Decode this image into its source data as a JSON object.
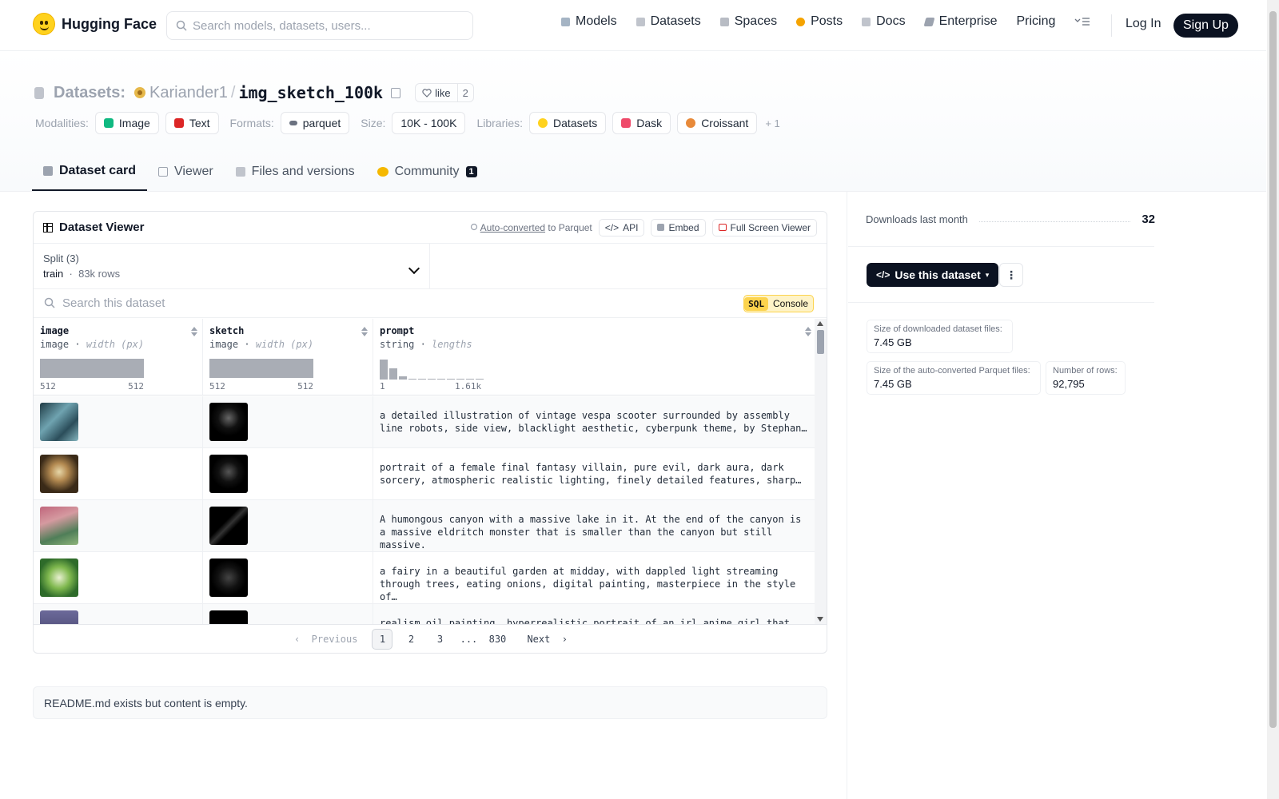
{
  "nav": {
    "brand": "Hugging Face",
    "search_placeholder": "Search models, datasets, users...",
    "links": [
      "Models",
      "Datasets",
      "Spaces",
      "Posts",
      "Docs",
      "Enterprise",
      "Pricing"
    ],
    "login": "Log In",
    "signup": "Sign Up"
  },
  "header": {
    "section": "Datasets:",
    "owner": "Kariander1",
    "slash": "/",
    "name": "img_sketch_100k",
    "like_label": "like",
    "like_count": "2",
    "modalities_label": "Modalities:",
    "modalities": [
      "Image",
      "Text"
    ],
    "formats_label": "Formats:",
    "formats": [
      "parquet"
    ],
    "size_label": "Size:",
    "size": "10K - 100K",
    "libraries_label": "Libraries:",
    "libraries": [
      "Datasets",
      "Dask",
      "Croissant"
    ],
    "libraries_more": "+ 1"
  },
  "tabs": [
    {
      "label": "Dataset card",
      "active": true
    },
    {
      "label": "Viewer"
    },
    {
      "label": "Files and versions"
    },
    {
      "label": "Community",
      "badge": "1"
    }
  ],
  "viewer": {
    "title": "Dataset Viewer",
    "auto_converted": "Auto-converted",
    "to_parquet": "to Parquet",
    "api": "API",
    "embed": "Embed",
    "fullscreen": "Full Screen Viewer",
    "split_label": "Split (3)",
    "split_name": "train",
    "split_rows": "83k rows",
    "search_placeholder": "Search this dataset",
    "sql_tag": "SQL",
    "sql_label": "Console",
    "columns": [
      {
        "name": "image",
        "type": "image",
        "stat": "width (px)",
        "min": "512",
        "max": "512"
      },
      {
        "name": "sketch",
        "type": "image",
        "stat": "width (px)",
        "min": "512",
        "max": "512"
      },
      {
        "name": "prompt",
        "type": "string",
        "stat": "lengths",
        "min": "1",
        "max": "1.61k"
      }
    ],
    "prompt_hist": [
      0.95,
      0.55,
      0.15,
      0.05,
      0.05,
      0.05,
      0.05,
      0.05,
      0.05,
      0.05,
      0.05
    ],
    "rows": [
      "a detailed illustration of vintage vespa scooter surrounded by assembly line robots, side view, blacklight aesthetic, cyberpunk theme, by Stephan…",
      "portrait of a female final fantasy villain, pure evil, dark aura, dark sorcery, atmospheric realistic lighting, finely detailed features, sharp…",
      "A humongous canyon with a massive lake in it. At the end of the canyon is a massive eldritch monster that is smaller than the canyon but still massive.",
      "a fairy in a beautiful garden at midday, with dappled light streaming through trees, eating onions, digital painting, masterpiece in the style of…",
      "realism oil painting, hyperrealistic portrait of an irl anime girl that is…"
    ],
    "pager": {
      "previous": "Previous",
      "pages": [
        "1",
        "2",
        "3",
        "...",
        "830"
      ],
      "next": "Next"
    }
  },
  "readme": "README.md exists but content is empty.",
  "sidebar": {
    "downloads_label": "Downloads last month",
    "downloads": "32",
    "use_button": "Use this dataset",
    "stats": [
      {
        "k": "Size of downloaded dataset files:",
        "v": "7.45 GB"
      },
      {
        "k": "Size of the auto-converted Parquet files:",
        "v": "7.45 GB"
      },
      {
        "k": "Number of rows:",
        "v": "92,795"
      }
    ]
  },
  "colors": {
    "accent": "#0b1221",
    "brand": "#ffd21e"
  }
}
